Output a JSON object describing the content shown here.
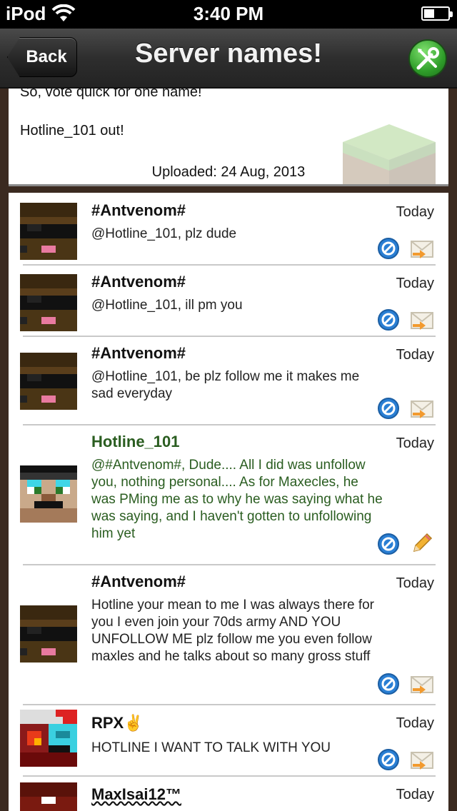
{
  "status_bar": {
    "carrier": "iPod",
    "time": "3:40 PM"
  },
  "nav": {
    "back_label": "Back",
    "title": "Server names!"
  },
  "post": {
    "line1": "So, vote quick for one name!",
    "line2": "Hotline_101 out!",
    "uploaded": "Uploaded: 24 Aug, 2013"
  },
  "comments": [
    {
      "author": "#Antvenom#",
      "time": "Today",
      "text": "@Hotline_101, plz dude"
    },
    {
      "author": "#Antvenom#",
      "time": "Today",
      "text": "@Hotline_101, ill pm you"
    },
    {
      "author": "#Antvenom#",
      "time": "Today",
      "text": "@Hotline_101, be plz follow me it makes me sad everyday"
    },
    {
      "author": "Hotline_101",
      "time": "Today",
      "text": "@#Antvenom#, Dude.... All I did was unfollow you, nothing personal.... As for Maxecles, he was PMing me as to why he was saying what he was saying, and I haven't gotten to unfollowing him yet"
    },
    {
      "author": "#Antvenom#",
      "time": "Today",
      "text": "Hotline your mean to me I was always there for you I even join your 70ds army AND YOU UNFOLLOW ME plz follow me you even follow maxles and he talks about so many gross stuff"
    },
    {
      "author": "RPX✌",
      "time": "Today",
      "text": "HOTLINE I WANT TO TALK WITH YOU"
    },
    {
      "author": "MaxIsai12™",
      "time": "Today",
      "text": ""
    }
  ],
  "colors": {
    "own_comment": "#2a5d20",
    "nav_bg": "#2e2e2e",
    "frame_bg": "#3b2a20"
  },
  "icons": {
    "block": "block-icon",
    "reply": "reply-envelope-icon",
    "edit": "pencil-icon",
    "tools": "tools-icon"
  }
}
